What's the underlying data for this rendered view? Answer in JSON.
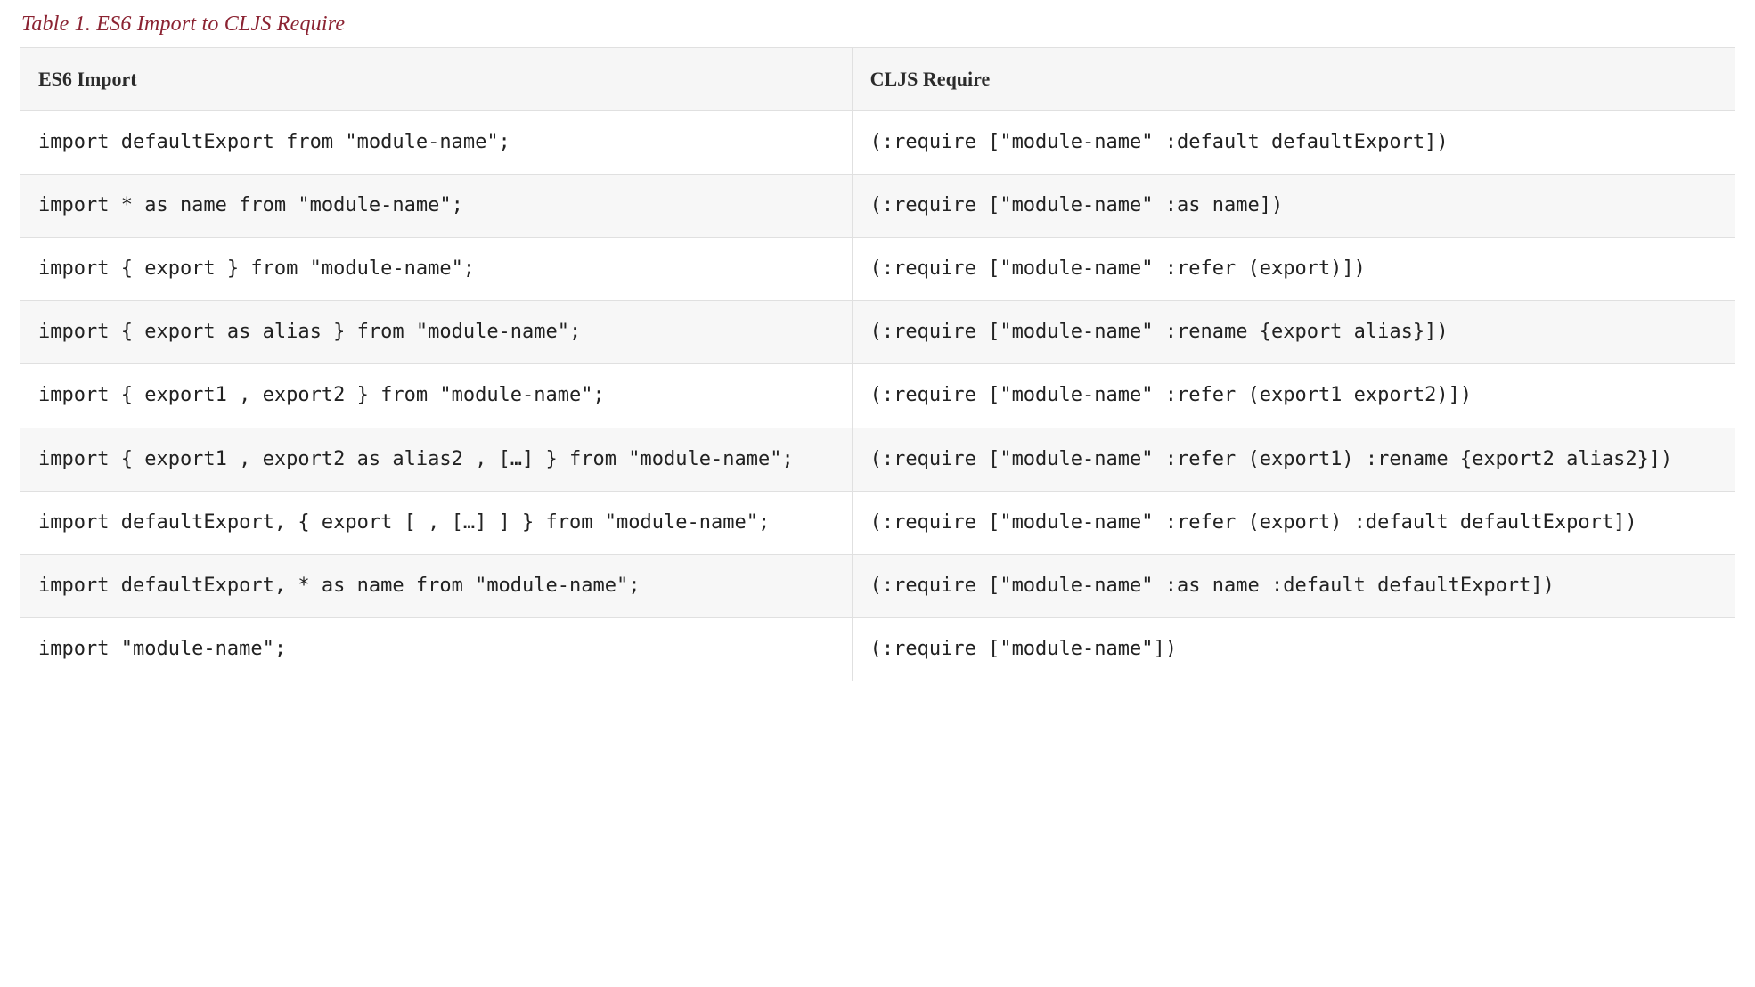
{
  "caption": "Table 1. ES6 Import to CLJS Require",
  "headers": {
    "es6": "ES6 Import",
    "cljs": "CLJS Require"
  },
  "rows": [
    {
      "es6": "import defaultExport from \"module-name\";",
      "cljs": "(:require [\"module-name\" :default defaultExport])"
    },
    {
      "es6": "import * as name from \"module-name\";",
      "cljs": "(:require [\"module-name\" :as name])"
    },
    {
      "es6": "import { export } from \"module-name\";",
      "cljs": "(:require [\"module-name\" :refer (export)])"
    },
    {
      "es6": "import { export as alias } from \"module-name\";",
      "cljs": "(:require [\"module-name\" :rename {export alias}])"
    },
    {
      "es6": "import { export1 , export2 } from \"module-name\";",
      "cljs": "(:require [\"module-name\" :refer (export1 export2)])"
    },
    {
      "es6": "import { export1 , export2 as alias2 , […] } from \"module-name\";",
      "cljs": "(:require [\"module-name\" :refer (export1) :rename {export2 alias2}])"
    },
    {
      "es6": "import defaultExport, { export [ , […] ] } from \"module-name\";",
      "cljs": "(:require [\"module-name\" :refer (export) :default defaultExport])"
    },
    {
      "es6": "import defaultExport, * as name from \"module-name\";",
      "cljs": "(:require [\"module-name\" :as name :default defaultExport])"
    },
    {
      "es6": "import \"module-name\";",
      "cljs": "(:require [\"module-name\"])"
    }
  ]
}
